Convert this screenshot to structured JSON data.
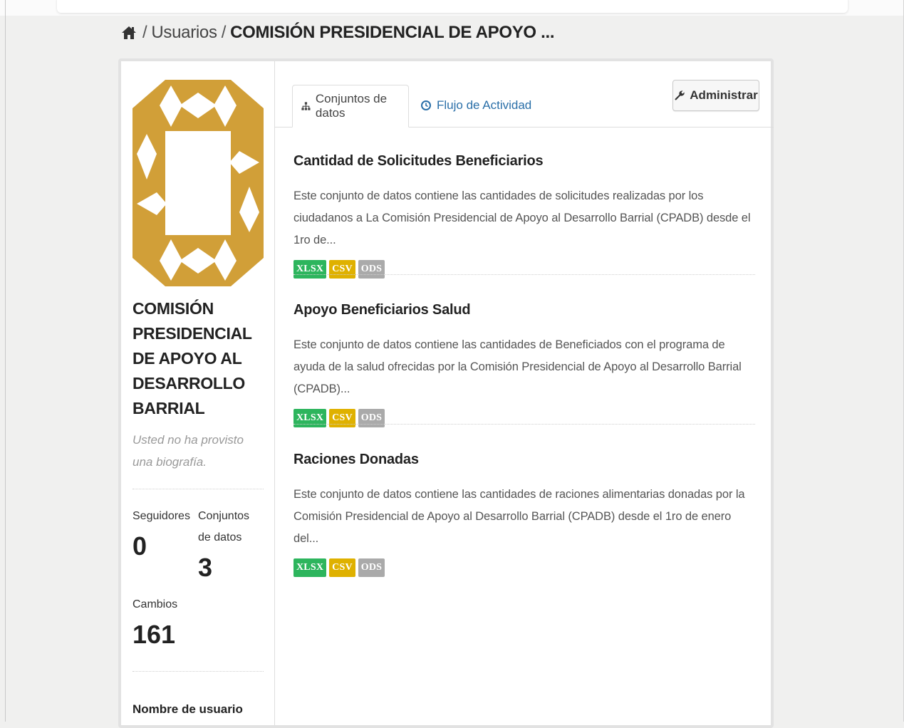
{
  "breadcrumb": {
    "home_icon": "home-icon",
    "items": [
      "Usuarios",
      "COMISIÓN PRESIDENCIAL DE APOYO ..."
    ],
    "separator": "/"
  },
  "profile": {
    "name": "COMISIÓN PRESIDENCIAL DE APOYO AL DESARROLLO BARRIAL",
    "bio": "Usted no ha provisto una biografía.",
    "stats": {
      "followers_label": "Seguidores",
      "followers_value": "0",
      "datasets_label": "Conjuntos de datos",
      "datasets_value": "3",
      "edits_label": "Cambios",
      "edits_value": "161"
    },
    "username_label": "Nombre de usuario",
    "logo_color": "#d19f38"
  },
  "tabs": [
    {
      "label": "Conjuntos de datos",
      "icon": "sitemap-icon",
      "active": true
    },
    {
      "label": "Flujo de Actividad",
      "icon": "clock-icon",
      "active": false
    }
  ],
  "admin_button": {
    "label": "Administrar",
    "icon": "wrench-icon"
  },
  "datasets": [
    {
      "title": "Cantidad de Solicitudes Beneficiarios",
      "description": "Este conjunto de datos contiene las cantidades de solicitudes realizadas por los ciudadanos a La Comisión Presidencial de Apoyo al Desarrollo Barrial (CPADB) desde el 1ro de...",
      "formats": [
        "XLSX",
        "CSV",
        "ODS"
      ]
    },
    {
      "title": "Apoyo Beneficiarios Salud",
      "description": "Este conjunto de datos contiene las cantidades de Beneficiados con el programa de ayuda de la salud ofrecidas por la Comisión Presidencial de Apoyo al Desarrollo Barrial (CPADB)...",
      "formats": [
        "XLSX",
        "CSV",
        "ODS"
      ]
    },
    {
      "title": "Raciones Donadas",
      "description": "Este conjunto de datos contiene las cantidades de raciones alimentarias donadas por la Comisión Presidencial de Apoyo al Desarrollo Barrial (CPADB) desde el 1ro de enero del...",
      "formats": [
        "XLSX",
        "CSV",
        "ODS"
      ]
    }
  ],
  "format_colors": {
    "XLSX": "#2db55d",
    "CSV": "#dfb100",
    "ODS": "#aaaaaa"
  },
  "colors": {
    "link": "#2a6fa8",
    "background": "#f0f0ef"
  }
}
